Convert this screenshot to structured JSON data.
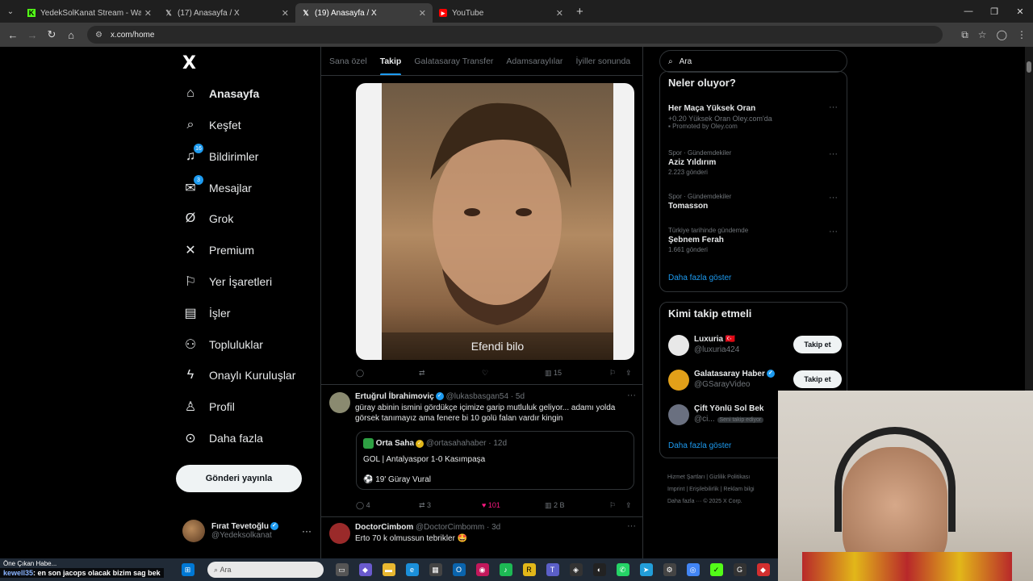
{
  "browser": {
    "tabs": [
      {
        "title": "YedekSolKanat Stream - Watch",
        "favicon": "kick",
        "color": "#53fc18"
      },
      {
        "title": "(17) Anasayfa / X",
        "favicon": "x"
      },
      {
        "title": "(19) Anasayfa / X",
        "favicon": "x",
        "active": true
      },
      {
        "title": "YouTube",
        "favicon": "youtube",
        "color": "#ff0000"
      }
    ],
    "url": "x.com/home"
  },
  "nav": {
    "logo": "X",
    "items": [
      {
        "label": "Anasayfa",
        "icon": "home-icon",
        "glyph": "⌂"
      },
      {
        "label": "Keşfet",
        "icon": "search-icon",
        "glyph": "⌕"
      },
      {
        "label": "Bildirimler",
        "icon": "bell-icon",
        "glyph": "🔔",
        "badge": "16"
      },
      {
        "label": "Mesajlar",
        "icon": "mail-icon",
        "glyph": "✉",
        "badge": "3"
      },
      {
        "label": "Grok",
        "icon": "grok-icon",
        "glyph": "Ø"
      },
      {
        "label": "Premium",
        "icon": "x-premium-icon",
        "glyph": "X"
      },
      {
        "label": "Yer İşaretleri",
        "icon": "bookmark-icon",
        "glyph": "⚑"
      },
      {
        "label": "İşler",
        "icon": "briefcase-icon",
        "glyph": "▤"
      },
      {
        "label": "Topluluklar",
        "icon": "communities-icon",
        "glyph": "⚇"
      },
      {
        "label": "Onaylı Kuruluşlar",
        "icon": "lightning-icon",
        "glyph": "ϟ"
      },
      {
        "label": "Profil",
        "icon": "person-icon",
        "glyph": "♙"
      },
      {
        "label": "Daha fazla",
        "icon": "more-circle-icon",
        "glyph": "⊙"
      }
    ],
    "post_button": "Gönderi yayınla",
    "profile": {
      "name": "Fırat Tevetoğlu",
      "handle": "@Yedeksolkanat"
    }
  },
  "feed": {
    "tabs": [
      "Sana özel",
      "Takip",
      "Galatasaray Transfer",
      "Adamsaraylılar",
      "İyiller sonunda"
    ],
    "active_tab": 1,
    "image_caption": "Efendi bilo",
    "image_actions": {
      "views": "15"
    },
    "post1": {
      "name": "Ertuğrul İbrahimoviç",
      "handle": "@lukasbasgan54 · 5d",
      "text": "güray abinin ismini gördükçe içimize garip mutluluk geliyor... adamı yolda görsek tanımayız ama fenere bi 10 golü falan vardır kingin",
      "quote": {
        "name": "Orta Saha",
        "handle": "@ortasahahaber · 12d",
        "line1": "GOL | Antalyaspor 1-0 Kasımpaşa",
        "line2": "⚽ 19' Güray Vural"
      },
      "replies": "4",
      "reposts": "3",
      "likes": "101",
      "views": "2 B"
    },
    "post2": {
      "name": "DoctorCimbom",
      "handle": "@DoctorCimbomm · 3d",
      "text": "Erto 70 k olmussun tebrikler 🤩"
    }
  },
  "right": {
    "search_placeholder": "Ara",
    "trends_title": "Neler oluyor?",
    "trends": [
      {
        "meta": "",
        "name": "Her Maça Yüksek Oran",
        "sub": "+0.20 Yüksek Oran Oley.com'da",
        "count": "Promoted by Oley.com"
      },
      {
        "meta": "Spor · Gündemdekiler",
        "name": "Aziz Yıldırım",
        "count": "2.223 gönderi"
      },
      {
        "meta": "Spor · Gündemdekiler",
        "name": "Tomasson",
        "count": ""
      },
      {
        "meta": "Türkiye tarihinde gündemde",
        "name": "Şebnem Ferah",
        "count": "1.661 gönderi"
      }
    ],
    "show_more": "Daha fazla göster",
    "follow_title": "Kimi takip etmeli",
    "follow": [
      {
        "name": "Luxuria 🇹🇷",
        "handle": "@luxuria424",
        "button": "Takip et"
      },
      {
        "name": "Galatasaray Haber",
        "handle": "@GSarayVideo",
        "button": "Takip et"
      },
      {
        "name": "Çift Yönlü Sol Bek",
        "handle": "@ci...",
        "tag": "Seni takip ediyor"
      }
    ],
    "follow_more": "Daha fazla göster",
    "footer": [
      "Hizmet Şartları",
      "Gizlilik Politikası",
      "Imprint",
      "Erişilebilirlik",
      "Reklam bilgi",
      "Daha fazla ···",
      "© 2025 X Corp."
    ]
  },
  "overlay": {
    "notif": "Öne Çıkan Habe...",
    "chat_user": "kewell35",
    "chat_text": ": en son jacops olacak bizim sag bek",
    "taskbar_search": "Ara"
  }
}
